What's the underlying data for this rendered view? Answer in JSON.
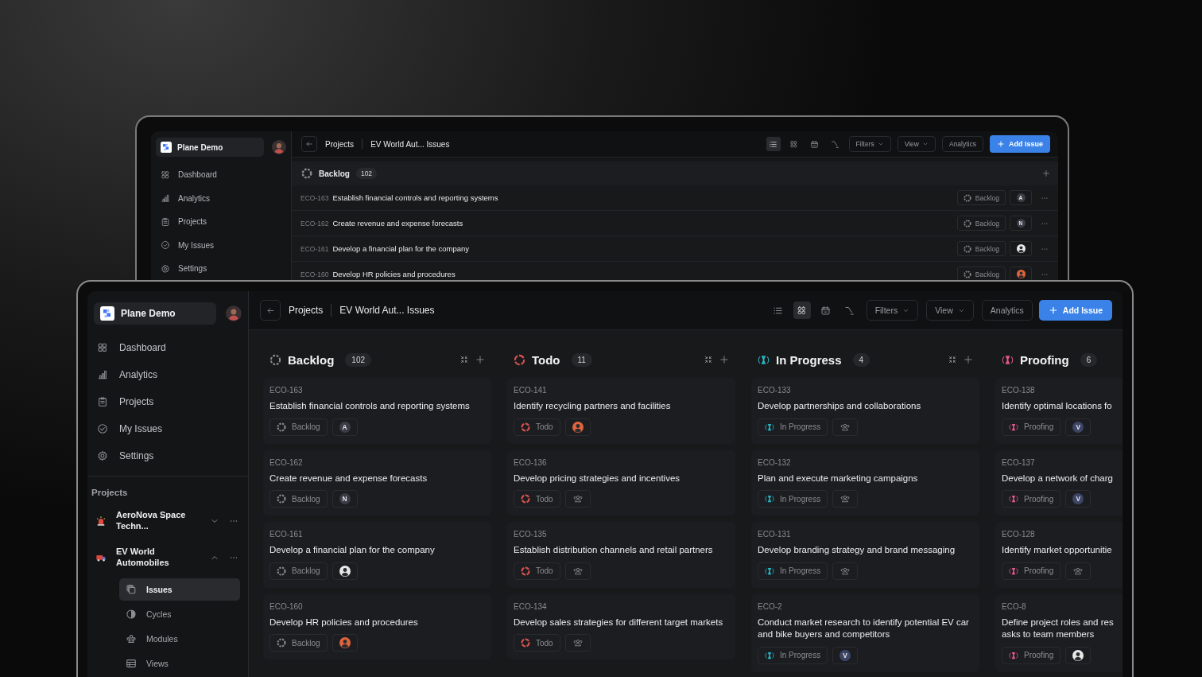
{
  "back_window": {
    "workspace": "Plane Demo",
    "nav": [
      "Dashboard",
      "Analytics",
      "Projects",
      "My Issues",
      "Settings"
    ],
    "breadcrumb": [
      "Projects",
      "EV World Aut... Issues"
    ],
    "layouts": [
      {
        "selected": true
      },
      {
        "selected": false
      },
      {
        "selected": false
      },
      {
        "selected": false
      }
    ],
    "filters": "Filters",
    "view": "View",
    "analytics": "Analytics",
    "add_issue": "Add Issue",
    "group": {
      "name": "Backlog",
      "count": "102",
      "kind": "backlog",
      "color": "#8b8b8e"
    },
    "rows": [
      {
        "id": "ECO-163",
        "title": "Establish financial controls and reporting systems",
        "state": "Backlog",
        "assignee": {
          "kind": "letter",
          "text": "A",
          "color": "#3a3d46"
        }
      },
      {
        "id": "ECO-162",
        "title": "Create revenue and expense forecasts",
        "state": "Backlog",
        "assignee": {
          "kind": "letter",
          "text": "N",
          "color": "#3a3d46"
        }
      },
      {
        "id": "ECO-161",
        "title": "Develop a financial plan for the company",
        "state": "Backlog",
        "assignee": {
          "kind": "photo",
          "color": "#e8e8e8"
        }
      },
      {
        "id": "ECO-160",
        "title": "Develop HR policies and procedures",
        "state": "Backlog",
        "assignee": {
          "kind": "photo",
          "color": "#e0643c"
        }
      }
    ]
  },
  "front_window": {
    "workspace": "Plane Demo",
    "nav": [
      "Dashboard",
      "Analytics",
      "Projects",
      "My Issues",
      "Settings"
    ],
    "projects_heading": "Projects",
    "projects": [
      {
        "name": "AeroNova Space Techn...",
        "expanded": false
      },
      {
        "name": "EV World Automobiles",
        "expanded": true,
        "children": [
          {
            "label": "Issues",
            "selected": true
          },
          {
            "label": "Cycles",
            "selected": false
          },
          {
            "label": "Modules",
            "selected": false
          },
          {
            "label": "Views",
            "selected": false
          }
        ]
      }
    ],
    "breadcrumb": [
      "Projects",
      "EV World Aut... Issues"
    ],
    "layouts": [
      {
        "selected": false
      },
      {
        "selected": true
      },
      {
        "selected": false
      },
      {
        "selected": false
      }
    ],
    "filters": "Filters",
    "view": "View",
    "analytics": "Analytics",
    "add_issue": "Add Issue",
    "columns": [
      {
        "name": "Backlog",
        "count": "102",
        "kind": "backlog",
        "color": "#8b8b8e",
        "cards": [
          {
            "id": "ECO-163",
            "title": "Establish financial controls and reporting systems",
            "state": "Backlog",
            "assignee": {
              "kind": "letter",
              "text": "A",
              "color": "#3a3d46"
            }
          },
          {
            "id": "ECO-162",
            "title": "Create revenue and expense forecasts",
            "state": "Backlog",
            "assignee": {
              "kind": "letter",
              "text": "N",
              "color": "#3a3d46"
            }
          },
          {
            "id": "ECO-161",
            "title": "Develop a financial plan for the company",
            "state": "Backlog",
            "assignee": {
              "kind": "photo",
              "color": "#e8e8e8"
            }
          },
          {
            "id": "ECO-160",
            "title": "Develop HR policies and procedures",
            "state": "Backlog",
            "assignee": {
              "kind": "photo",
              "color": "#e0643c"
            }
          }
        ]
      },
      {
        "name": "Todo",
        "count": "11",
        "kind": "unstarted",
        "color": "#d9534f",
        "cards": [
          {
            "id": "ECO-141",
            "title": "Identify recycling partners and facilities",
            "state": "Todo",
            "assignee": {
              "kind": "photo",
              "color": "#e0643c"
            }
          },
          {
            "id": "ECO-136",
            "title": "Develop pricing strategies and incentives",
            "state": "Todo",
            "assignee": {
              "kind": "unassigned"
            }
          },
          {
            "id": "ECO-135",
            "title": "Establish distribution channels and retail partners",
            "state": "Todo",
            "assignee": {
              "kind": "unassigned"
            }
          },
          {
            "id": "ECO-134",
            "title": "Develop sales strategies for different target markets",
            "state": "Todo",
            "assignee": {
              "kind": "unassigned"
            }
          }
        ]
      },
      {
        "name": "In Progress",
        "count": "4",
        "kind": "started",
        "color": "#2ab3c4",
        "cards": [
          {
            "id": "ECO-133",
            "title": "Develop partnerships and collaborations",
            "state": "In Progress",
            "assignee": {
              "kind": "unassigned"
            }
          },
          {
            "id": "ECO-132",
            "title": "Plan and execute marketing campaigns",
            "state": "In Progress",
            "assignee": {
              "kind": "unassigned"
            }
          },
          {
            "id": "ECO-131",
            "title": "Develop branding strategy and brand messaging",
            "state": "In Progress",
            "assignee": {
              "kind": "unassigned"
            }
          },
          {
            "id": "ECO-2",
            "title": "Conduct market research to identify potential EV car and bike buyers and competitors",
            "state": "In Progress",
            "assignee": {
              "kind": "letter",
              "text": "V",
              "color": "#3d4566"
            }
          }
        ]
      },
      {
        "name": "Proofing",
        "count": "6",
        "kind": "review",
        "color": "#e05a8a",
        "cards": [
          {
            "id": "ECO-138",
            "title": "Identify optimal locations fo",
            "state": "Proofing",
            "assignee": {
              "kind": "letter",
              "text": "V",
              "color": "#3d4566"
            }
          },
          {
            "id": "ECO-137",
            "title": "Develop a network of charg",
            "state": "Proofing",
            "assignee": {
              "kind": "letter",
              "text": "V",
              "color": "#3d4566"
            }
          },
          {
            "id": "ECO-128",
            "title": "Identify market opportunitie",
            "state": "Proofing",
            "assignee": {
              "kind": "unassigned"
            }
          },
          {
            "id": "ECO-8",
            "title": "Define project roles and res\nasks to team members",
            "state": "Proofing",
            "assignee": {
              "kind": "photo",
              "color": "#e8e8e8"
            }
          }
        ]
      }
    ]
  }
}
